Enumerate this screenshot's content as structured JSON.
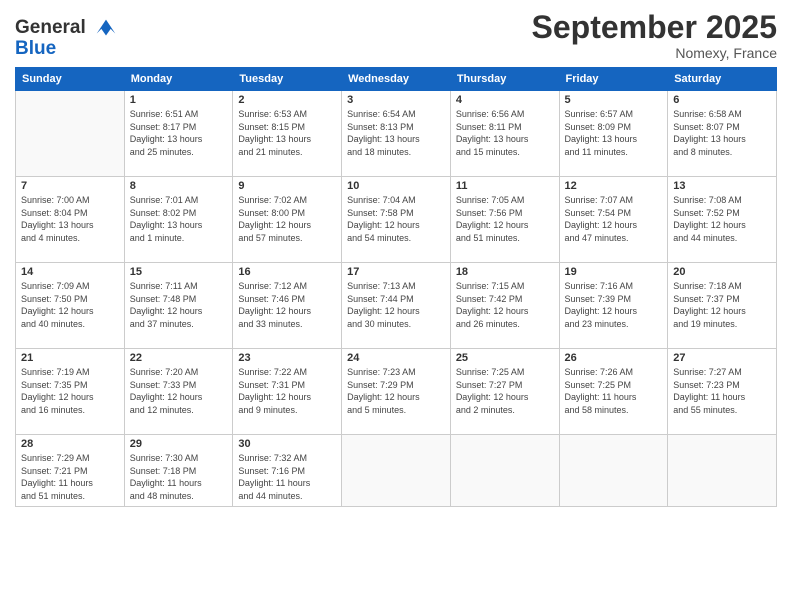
{
  "logo": {
    "line1": "General",
    "line2": "Blue"
  },
  "title": "September 2025",
  "location": "Nomexy, France",
  "days_header": [
    "Sunday",
    "Monday",
    "Tuesday",
    "Wednesday",
    "Thursday",
    "Friday",
    "Saturday"
  ],
  "weeks": [
    [
      {
        "num": "",
        "info": ""
      },
      {
        "num": "1",
        "info": "Sunrise: 6:51 AM\nSunset: 8:17 PM\nDaylight: 13 hours\nand 25 minutes."
      },
      {
        "num": "2",
        "info": "Sunrise: 6:53 AM\nSunset: 8:15 PM\nDaylight: 13 hours\nand 21 minutes."
      },
      {
        "num": "3",
        "info": "Sunrise: 6:54 AM\nSunset: 8:13 PM\nDaylight: 13 hours\nand 18 minutes."
      },
      {
        "num": "4",
        "info": "Sunrise: 6:56 AM\nSunset: 8:11 PM\nDaylight: 13 hours\nand 15 minutes."
      },
      {
        "num": "5",
        "info": "Sunrise: 6:57 AM\nSunset: 8:09 PM\nDaylight: 13 hours\nand 11 minutes."
      },
      {
        "num": "6",
        "info": "Sunrise: 6:58 AM\nSunset: 8:07 PM\nDaylight: 13 hours\nand 8 minutes."
      }
    ],
    [
      {
        "num": "7",
        "info": "Sunrise: 7:00 AM\nSunset: 8:04 PM\nDaylight: 13 hours\nand 4 minutes."
      },
      {
        "num": "8",
        "info": "Sunrise: 7:01 AM\nSunset: 8:02 PM\nDaylight: 13 hours\nand 1 minute."
      },
      {
        "num": "9",
        "info": "Sunrise: 7:02 AM\nSunset: 8:00 PM\nDaylight: 12 hours\nand 57 minutes."
      },
      {
        "num": "10",
        "info": "Sunrise: 7:04 AM\nSunset: 7:58 PM\nDaylight: 12 hours\nand 54 minutes."
      },
      {
        "num": "11",
        "info": "Sunrise: 7:05 AM\nSunset: 7:56 PM\nDaylight: 12 hours\nand 51 minutes."
      },
      {
        "num": "12",
        "info": "Sunrise: 7:07 AM\nSunset: 7:54 PM\nDaylight: 12 hours\nand 47 minutes."
      },
      {
        "num": "13",
        "info": "Sunrise: 7:08 AM\nSunset: 7:52 PM\nDaylight: 12 hours\nand 44 minutes."
      }
    ],
    [
      {
        "num": "14",
        "info": "Sunrise: 7:09 AM\nSunset: 7:50 PM\nDaylight: 12 hours\nand 40 minutes."
      },
      {
        "num": "15",
        "info": "Sunrise: 7:11 AM\nSunset: 7:48 PM\nDaylight: 12 hours\nand 37 minutes."
      },
      {
        "num": "16",
        "info": "Sunrise: 7:12 AM\nSunset: 7:46 PM\nDaylight: 12 hours\nand 33 minutes."
      },
      {
        "num": "17",
        "info": "Sunrise: 7:13 AM\nSunset: 7:44 PM\nDaylight: 12 hours\nand 30 minutes."
      },
      {
        "num": "18",
        "info": "Sunrise: 7:15 AM\nSunset: 7:42 PM\nDaylight: 12 hours\nand 26 minutes."
      },
      {
        "num": "19",
        "info": "Sunrise: 7:16 AM\nSunset: 7:39 PM\nDaylight: 12 hours\nand 23 minutes."
      },
      {
        "num": "20",
        "info": "Sunrise: 7:18 AM\nSunset: 7:37 PM\nDaylight: 12 hours\nand 19 minutes."
      }
    ],
    [
      {
        "num": "21",
        "info": "Sunrise: 7:19 AM\nSunset: 7:35 PM\nDaylight: 12 hours\nand 16 minutes."
      },
      {
        "num": "22",
        "info": "Sunrise: 7:20 AM\nSunset: 7:33 PM\nDaylight: 12 hours\nand 12 minutes."
      },
      {
        "num": "23",
        "info": "Sunrise: 7:22 AM\nSunset: 7:31 PM\nDaylight: 12 hours\nand 9 minutes."
      },
      {
        "num": "24",
        "info": "Sunrise: 7:23 AM\nSunset: 7:29 PM\nDaylight: 12 hours\nand 5 minutes."
      },
      {
        "num": "25",
        "info": "Sunrise: 7:25 AM\nSunset: 7:27 PM\nDaylight: 12 hours\nand 2 minutes."
      },
      {
        "num": "26",
        "info": "Sunrise: 7:26 AM\nSunset: 7:25 PM\nDaylight: 11 hours\nand 58 minutes."
      },
      {
        "num": "27",
        "info": "Sunrise: 7:27 AM\nSunset: 7:23 PM\nDaylight: 11 hours\nand 55 minutes."
      }
    ],
    [
      {
        "num": "28",
        "info": "Sunrise: 7:29 AM\nSunset: 7:21 PM\nDaylight: 11 hours\nand 51 minutes."
      },
      {
        "num": "29",
        "info": "Sunrise: 7:30 AM\nSunset: 7:18 PM\nDaylight: 11 hours\nand 48 minutes."
      },
      {
        "num": "30",
        "info": "Sunrise: 7:32 AM\nSunset: 7:16 PM\nDaylight: 11 hours\nand 44 minutes."
      },
      {
        "num": "",
        "info": ""
      },
      {
        "num": "",
        "info": ""
      },
      {
        "num": "",
        "info": ""
      },
      {
        "num": "",
        "info": ""
      }
    ]
  ]
}
